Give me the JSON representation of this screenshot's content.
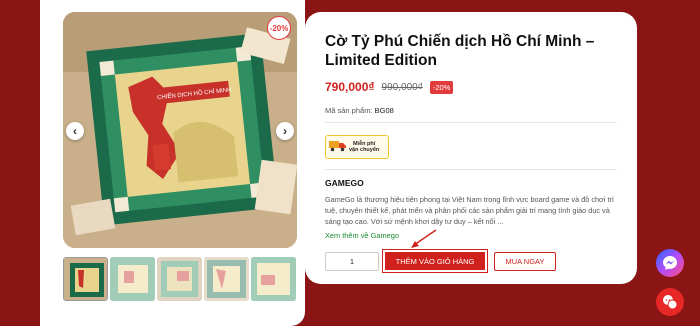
{
  "product": {
    "title": "Cờ Tỷ Phú Chiến dịch Hồ Chí Minh – Limited Edition",
    "price": "790,000₫",
    "old_price": "990,000₫",
    "discount": "-20%",
    "sku_label": "Mã sản phẩm:",
    "sku_value": "BG08"
  },
  "gallery": {
    "badge": "-20%",
    "prev_icon": "chevron-left-icon",
    "next_icon": "chevron-right-icon",
    "board_title": "CHIẾN DỊCH HỒ CHÍ MINH",
    "thumbnail_count": 5
  },
  "shipping": {
    "icon": "truck-icon",
    "line1": "Miễn phí",
    "line2": "vận chuyển"
  },
  "brand": {
    "name": "GAMEGO",
    "description": "GameGo là thương hiệu tiên phong tại Việt Nam trong lĩnh vực board game và đồ chơi trí tuệ, chuyên thiết kế, phát triển và phân phối các sản phẩm giải trí mang tính giáo dục và sáng tạo cao. Với sứ mệnh khơi dậy tư duy – kết nối ...",
    "link": "Xem thêm về Gamego"
  },
  "actions": {
    "quantity": "1",
    "add_to_cart": "THÊM VÀO GIỎ HÀNG",
    "buy_now": "MUA NGAY"
  },
  "floating": {
    "messenger_icon": "messenger-icon",
    "chat_icon": "chat-icon"
  },
  "colors": {
    "accent": "#d0211c",
    "background": "#8b1414",
    "link": "#1a8a32"
  }
}
